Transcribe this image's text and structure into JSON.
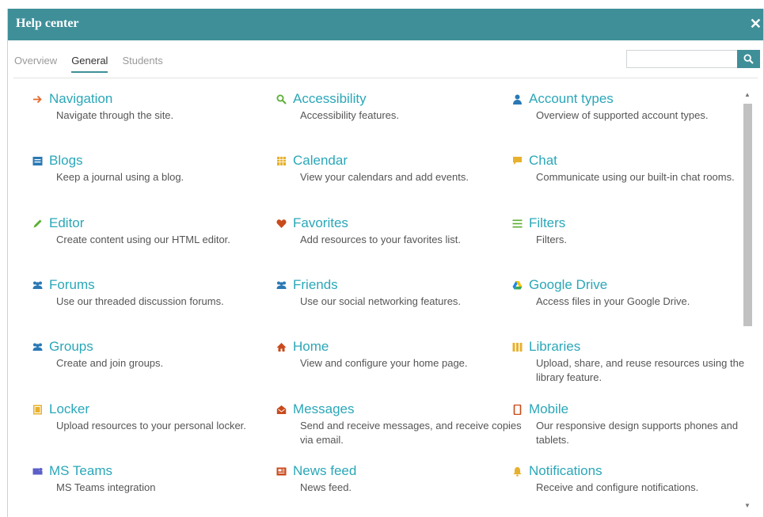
{
  "dialog": {
    "title": "Help center"
  },
  "tabs": [
    {
      "label": "Overview"
    },
    {
      "label": "General"
    },
    {
      "label": "Students"
    }
  ],
  "search": {
    "placeholder": ""
  },
  "items": [
    {
      "title": "Navigation",
      "desc": "Navigate through the site.",
      "icon": "arrow-right-icon",
      "color": "#e6682c"
    },
    {
      "title": "Accessibility",
      "desc": "Accessibility features.",
      "icon": "search-icon",
      "color": "#5aae32"
    },
    {
      "title": "Account types",
      "desc": "Overview of supported account types.",
      "icon": "user-icon",
      "color": "#2a79b5"
    },
    {
      "title": "Blogs",
      "desc": "Keep a journal using a blog.",
      "icon": "blog-icon",
      "color": "#2a79b5"
    },
    {
      "title": "Calendar",
      "desc": "View your calendars and add events.",
      "icon": "calendar-icon",
      "color": "#e8b12d"
    },
    {
      "title": "Chat",
      "desc": "Communicate using our built-in chat rooms.",
      "icon": "chat-icon",
      "color": "#e8b12d"
    },
    {
      "title": "Editor",
      "desc": "Create content using our HTML editor.",
      "icon": "pencil-icon",
      "color": "#5aae32"
    },
    {
      "title": "Favorites",
      "desc": "Add resources to your favorites list.",
      "icon": "heart-icon",
      "color": "#c94a1b"
    },
    {
      "title": "Filters",
      "desc": "Filters.",
      "icon": "filter-icon",
      "color": "#5aae32"
    },
    {
      "title": "Forums",
      "desc": "Use our threaded discussion forums.",
      "icon": "forums-icon",
      "color": "#2a79b5"
    },
    {
      "title": "Friends",
      "desc": "Use our social networking features.",
      "icon": "friends-icon",
      "color": "#2a79b5"
    },
    {
      "title": "Google Drive",
      "desc": "Access files in your Google Drive.",
      "icon": "google-drive-icon",
      "color": "#2a79b5"
    },
    {
      "title": "Groups",
      "desc": "Create and join groups.",
      "icon": "groups-icon",
      "color": "#2a79b5"
    },
    {
      "title": "Home",
      "desc": "View and configure your home page.",
      "icon": "home-icon",
      "color": "#c94a1b"
    },
    {
      "title": "Libraries",
      "desc": "Upload, share, and reuse resources using the library feature.",
      "icon": "library-icon",
      "color": "#e8b12d"
    },
    {
      "title": "Locker",
      "desc": "Upload resources to your personal locker.",
      "icon": "locker-icon",
      "color": "#e8b12d"
    },
    {
      "title": "Messages",
      "desc": "Send and receive messages, and receive copies via email.",
      "icon": "envelope-icon",
      "color": "#c94a1b"
    },
    {
      "title": "Mobile",
      "desc": "Our responsive design supports phones and tablets.",
      "icon": "mobile-icon",
      "color": "#c94a1b"
    },
    {
      "title": "MS Teams",
      "desc": "MS Teams integration",
      "icon": "ms-teams-icon",
      "color": "#5b5fc7"
    },
    {
      "title": "News feed",
      "desc": "News feed.",
      "icon": "newspaper-icon",
      "color": "#c94a1b"
    },
    {
      "title": "Notifications",
      "desc": "Receive and configure notifications.",
      "icon": "bell-icon",
      "color": "#e8b12d"
    }
  ],
  "colors": {
    "accent": "#3f8f99",
    "link": "#2aa7b8"
  }
}
